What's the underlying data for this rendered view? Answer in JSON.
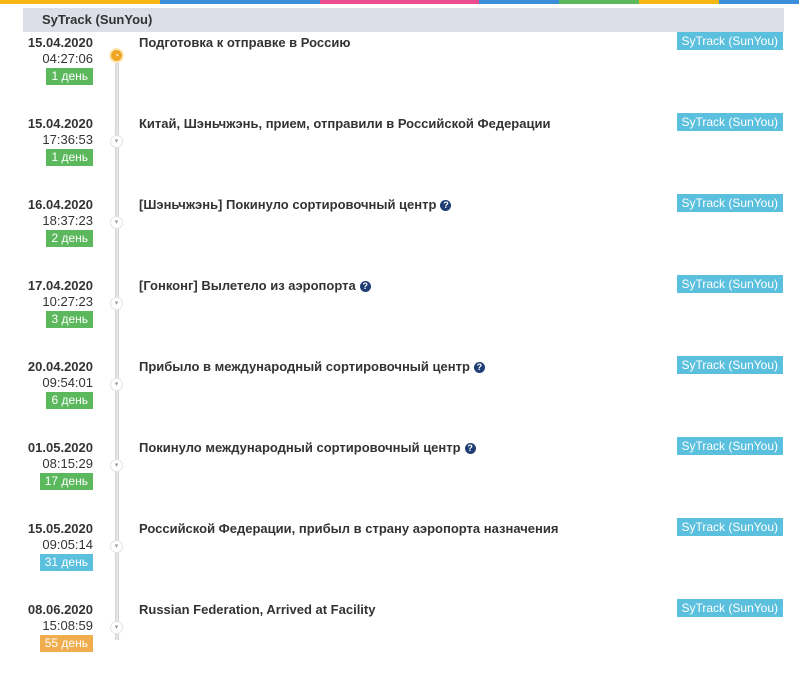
{
  "colors": {
    "header_bg": "#dcdfe7",
    "badge_green": "#5cb85c",
    "badge_blue": "#5bc0de",
    "badge_orange": "#f0ad4e",
    "carrier_badge": "#5bc0de",
    "help_icon": "#1f3f74",
    "first_node": "#f0a526"
  },
  "topbar_colors": [
    "#f7b717",
    "#f7b717",
    "#3b8ed8",
    "#3b8ed8",
    "#ee4c92",
    "#ee4c92",
    "#3b8ed8",
    "#5cb85c",
    "#f7b717",
    "#3b8ed8"
  ],
  "panel": {
    "title": "SyTrack (SunYou)"
  },
  "events": [
    {
      "date": "15.04.2020",
      "time": "04:27:06",
      "days": "1 день",
      "days_color": "green",
      "status": "Подготовка к отправке в Россию",
      "help": false,
      "carrier": "SyTrack (SunYou)",
      "icon": "clock-icon"
    },
    {
      "date": "15.04.2020",
      "time": "17:36:53",
      "days": "1 день",
      "days_color": "green",
      "status": "Китай, Шэньчжэнь, прием, отправили в Российской Федерации",
      "help": false,
      "carrier": "SyTrack (SunYou)",
      "icon": "chevron-down-icon"
    },
    {
      "date": "16.04.2020",
      "time": "18:37:23",
      "days": "2 день",
      "days_color": "green",
      "status": "[Шэньчжэнь] Покинуло сортировочный центр",
      "help": true,
      "carrier": "SyTrack (SunYou)",
      "icon": "chevron-down-icon"
    },
    {
      "date": "17.04.2020",
      "time": "10:27:23",
      "days": "3 день",
      "days_color": "green",
      "status": "[Гонконг] Вылетело из аэропорта",
      "help": true,
      "carrier": "SyTrack (SunYou)",
      "icon": "chevron-down-icon"
    },
    {
      "date": "20.04.2020",
      "time": "09:54:01",
      "days": "6 день",
      "days_color": "green",
      "status": "Прибыло в международный сортировочный центр",
      "help": true,
      "carrier": "SyTrack (SunYou)",
      "icon": "chevron-down-icon"
    },
    {
      "date": "01.05.2020",
      "time": "08:15:29",
      "days": "17 день",
      "days_color": "green",
      "status": "Покинуло международный сортировочный центр",
      "help": true,
      "carrier": "SyTrack (SunYou)",
      "icon": "chevron-down-icon"
    },
    {
      "date": "15.05.2020",
      "time": "09:05:14",
      "days": "31 день",
      "days_color": "blue",
      "status": "Российской Федерации, прибыл в страну аэропорта назначения",
      "help": false,
      "carrier": "SyTrack (SunYou)",
      "icon": "chevron-down-icon"
    },
    {
      "date": "08.06.2020",
      "time": "15:08:59",
      "days": "55 день",
      "days_color": "orange",
      "status": "Russian Federation, Arrived at Facility",
      "help": false,
      "carrier": "SyTrack (SunYou)",
      "icon": "chevron-down-icon"
    }
  ]
}
